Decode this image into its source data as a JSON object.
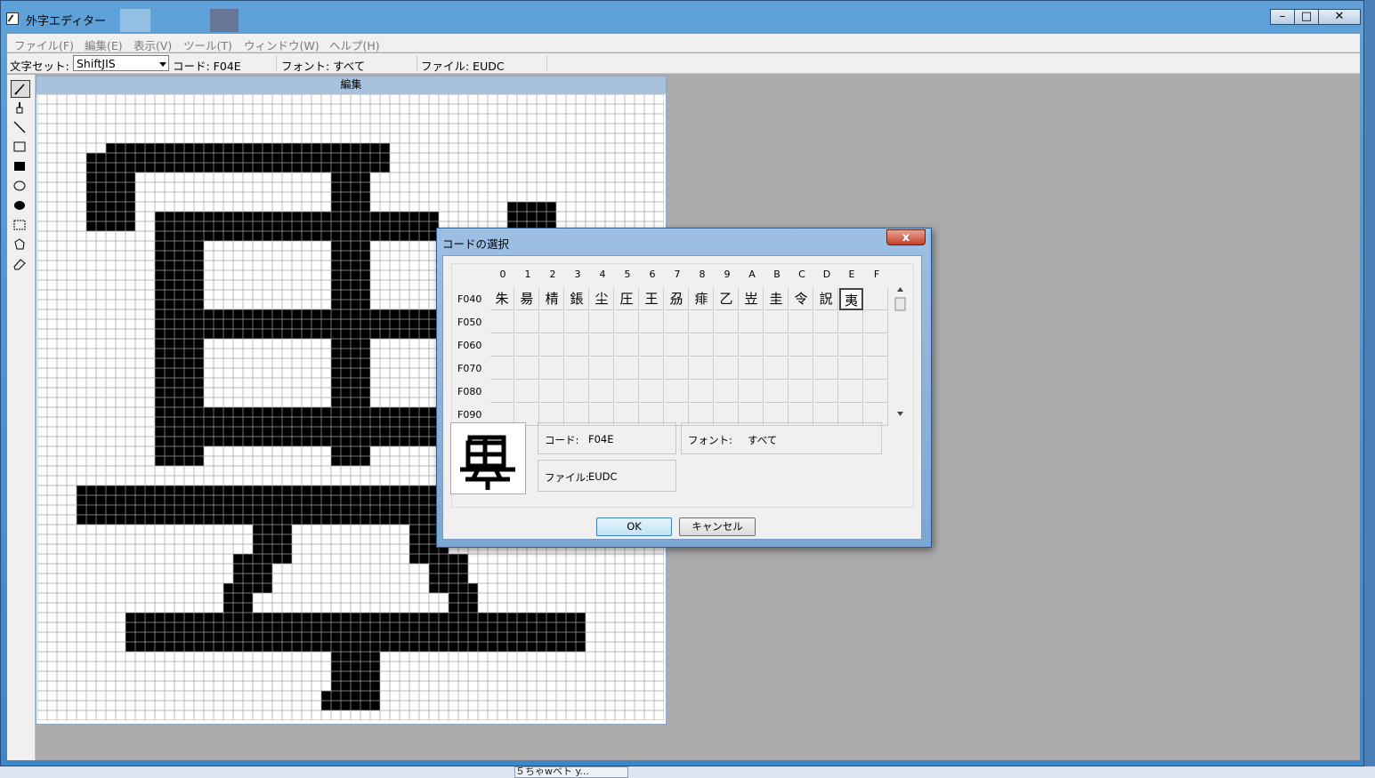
{
  "window": {
    "title": "外字エディター"
  },
  "menu": [
    "ファイル(F)",
    "編集(E)",
    "表示(V)",
    "ツール(T)",
    "ウィンドウ(W)",
    "ヘルプ(H)"
  ],
  "toolbar": {
    "charset_label": "文字セット:",
    "charset_value": "ShiftJIS",
    "code": "コード: F04E",
    "font": "フォント: すべて",
    "file": "ファイル: EUDC"
  },
  "tools": [
    "pencil-icon",
    "brush-icon",
    "line-icon",
    "hollow-rect-icon",
    "filled-rect-icon",
    "hollow-ellipse-icon",
    "filled-ellipse-icon",
    "rect-select-icon",
    "freeform-select-icon",
    "eraser-icon"
  ],
  "editor": {
    "title": "編集"
  },
  "dialog": {
    "title": "コードの選択",
    "close": "x",
    "columns": [
      "0",
      "1",
      "2",
      "3",
      "4",
      "5",
      "6",
      "7",
      "8",
      "9",
      "A",
      "B",
      "C",
      "D",
      "E",
      "F"
    ],
    "rows": [
      {
        "label": "F040",
        "cells": [
          "朱",
          "昜",
          "棈",
          "鋹",
          "尘",
          "圧",
          "王",
          "刕",
          "痱",
          "乙",
          "岦",
          "圭",
          "令",
          "詋",
          "夷",
          ""
        ]
      },
      {
        "label": "F050",
        "cells": []
      },
      {
        "label": "F060",
        "cells": []
      },
      {
        "label": "F070",
        "cells": []
      },
      {
        "label": "F080",
        "cells": []
      },
      {
        "label": "F090",
        "cells": []
      }
    ],
    "selected_column": "E",
    "selected_row": "F040",
    "code_label": "コード:",
    "code_value": "F04E",
    "font_label": "フォント:",
    "font_value": "すべて",
    "file_label": "ファイル:",
    "file_value": "EUDC",
    "ok": "OK",
    "cancel": "キャンセル"
  },
  "taskbar": {
    "item": "５ちゃwベト y..."
  }
}
